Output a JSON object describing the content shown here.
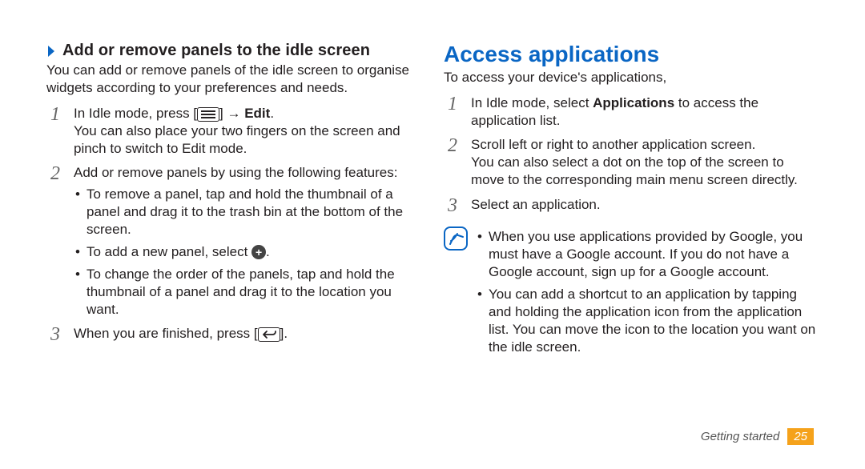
{
  "left": {
    "heading": "Add or remove panels to the idle screen",
    "intro": "You can add or remove panels of the idle screen to organise widgets according to your preferences and needs.",
    "step1": {
      "line1_before": "In Idle mode, press [",
      "line1_after": "] → ",
      "line1_bold": "Edit",
      "line1_period": ".",
      "line2": "You can also place your two fingers on the screen and pinch to switch to Edit mode."
    },
    "step2": {
      "intro": "Add or remove panels by using the following features:",
      "b1": "To remove a panel, tap and hold the thumbnail of a panel and drag it to the trash bin at the bottom of the screen.",
      "b2_before": "To add a new panel, select ",
      "b2_after": ".",
      "b3": "To change the order of the panels, tap and hold the thumbnail of a panel and drag it to the location you want."
    },
    "step3": {
      "before": "When you are finished, press [",
      "after": "]."
    }
  },
  "right": {
    "heading": "Access applications",
    "intro": "To access your device's applications,",
    "step1": {
      "before": "In Idle mode, select ",
      "bold": "Applications",
      "after": " to access the application list."
    },
    "step2": {
      "line1": "Scroll left or right to another application screen.",
      "line2": "You can also select a dot on the top of the screen to move to the corresponding main menu screen directly."
    },
    "step3": "Select an application.",
    "note": {
      "b1": "When you use applications provided by Google, you must have a Google account. If you do not have a Google account, sign up for a Google account.",
      "b2": "You can add a shortcut to an application by tapping and holding the application icon from the application list. You can move the icon to the location you want on the idle screen."
    }
  },
  "footer": {
    "section": "Getting started",
    "page": "25"
  }
}
